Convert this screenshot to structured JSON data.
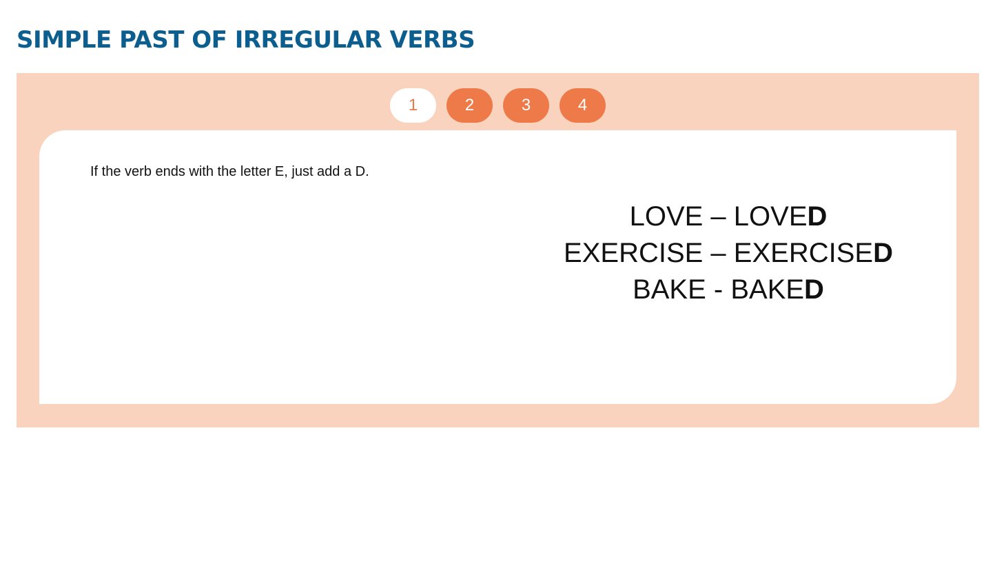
{
  "page": {
    "title": "SIMPLE PAST OF IRREGULAR VERBS"
  },
  "tabs": [
    {
      "label": "1",
      "active": true
    },
    {
      "label": "2",
      "active": false
    },
    {
      "label": "3",
      "active": false
    },
    {
      "label": "4",
      "active": false
    }
  ],
  "content": {
    "instruction": "If the verb ends with the letter E, just add a D.",
    "examples": [
      {
        "text": "LOVE – LOVE",
        "suffix": "D"
      },
      {
        "text": "EXERCISE – EXERCISE",
        "suffix": "D"
      },
      {
        "text": "BAKE - BAKE",
        "suffix": "D"
      }
    ]
  },
  "colors": {
    "title": "#0b5e8e",
    "panel_background": "#f9d3bd",
    "tab_inactive": "#ee7a4a",
    "tab_active_text": "#e8794c"
  }
}
